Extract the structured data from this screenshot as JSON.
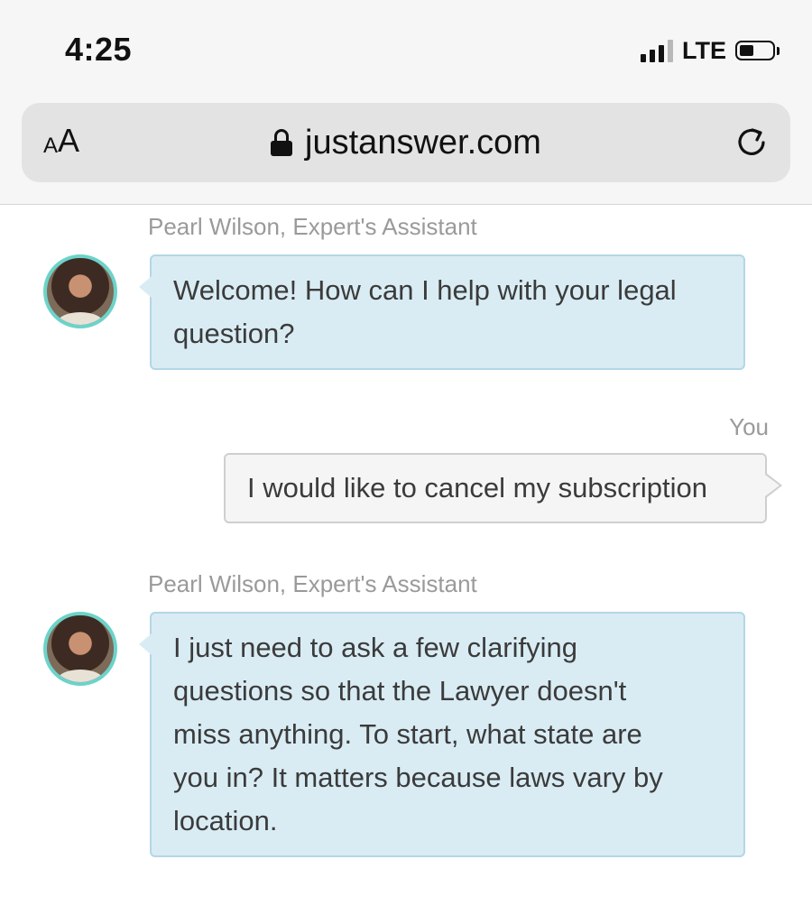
{
  "status_bar": {
    "time": "4:25",
    "network": "LTE",
    "signal_bars": 3,
    "battery_level": 0.45
  },
  "browser": {
    "text_size_label_small": "A",
    "text_size_label_big": "A",
    "url": "justanswer.com",
    "icons": [
      "lock-icon",
      "reload-icon"
    ]
  },
  "chat": {
    "messages": [
      {
        "sender": "Pearl Wilson, Expert's Assistant",
        "role": "expert",
        "lines": [
          "Welcome! How can I help with your legal",
          "question?"
        ]
      },
      {
        "sender": "You",
        "role": "user",
        "lines": [
          "I would like to cancel my subscription"
        ]
      },
      {
        "sender": "Pearl Wilson, Expert's Assistant",
        "role": "expert",
        "lines": [
          "I just need to ask a few clarifying",
          "questions so that the Lawyer doesn't",
          "miss anything. To start, what state are",
          "you in? It matters because laws vary by",
          "location."
        ]
      }
    ]
  },
  "colors": {
    "expert_bubble": "#d9ecf4",
    "expert_border": "#b3d6e6",
    "user_bubble": "#f5f5f5",
    "avatar_ring": "#6cd3c9"
  }
}
